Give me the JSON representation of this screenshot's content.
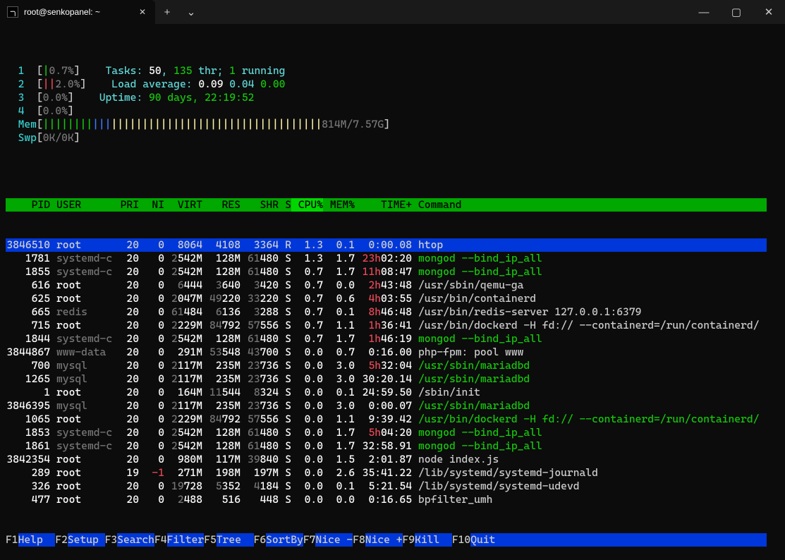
{
  "window": {
    "tab_title": "root@senkopanel: ~",
    "tab_icon": "terminal-icon",
    "close_glyph": "✕",
    "newtab_glyph": "+",
    "dropdown_glyph": "⌄",
    "min_glyph": "—",
    "max_glyph": "▢",
    "winclose_glyph": "✕"
  },
  "cpu_meters": [
    {
      "id": "1",
      "bar": "|",
      "bar_class": "green",
      "pct": "0.7%"
    },
    {
      "id": "2",
      "bar": "||",
      "bar_class": "red",
      "pct": "2.0%"
    },
    {
      "id": "3",
      "bar": "",
      "bar_class": "",
      "pct": "0.0%"
    },
    {
      "id": "4",
      "bar": "",
      "bar_class": "",
      "pct": "0.0%"
    }
  ],
  "mem": {
    "label": "Mem",
    "green_bars": 8,
    "blue_bars": 3,
    "yellow_bars": 34,
    "used": "814M",
    "total": "7.57G"
  },
  "swp": {
    "label": "Swp",
    "used": "0K",
    "total": "0K"
  },
  "tasks": {
    "label": "Tasks:",
    "procs": "50",
    "sep1": ",",
    "thr": "135",
    "thr_label": "thr;",
    "running": "1",
    "running_label": "running"
  },
  "load": {
    "label": "Load average:",
    "v1": "0.09",
    "v2": "0.04",
    "v3": "0.00"
  },
  "uptime": {
    "label": "Uptime:",
    "value": "90 days, 22:19:52"
  },
  "headers": {
    "pid": "PID",
    "user": "USER",
    "pri": "PRI",
    "ni": "NI",
    "virt": "VIRT",
    "res": "RES",
    "shr": "SHR",
    "s": "S",
    "cpu": "CPU%",
    "mem": "MEM%",
    "time": "TIME+",
    "cmd": "Command"
  },
  "processes": [
    {
      "pid": "3846510",
      "user": "root",
      "uclr": "bwhite",
      "pri": "20",
      "ni": "0",
      "virt": "8064",
      "res": "4108",
      "shr": "3364",
      "s": "R",
      "cpu": "1.3",
      "mem": "0.1",
      "time_red": "",
      "time_rest": "0:00.08",
      "cmd": "htop",
      "cmd_clr": "",
      "sel": true
    },
    {
      "pid": "1781",
      "user": "systemd-c",
      "uclr": "dim",
      "pri": "20",
      "ni": "0",
      "virt": "2542M",
      "res": "128M",
      "shr": "61480",
      "s": "S",
      "cpu": "1.3",
      "mem": "1.7",
      "time_red": "23h",
      "time_rest": "02:20",
      "cmd": "mongod --bind_ip_all",
      "cmd_clr": "green"
    },
    {
      "pid": "1855",
      "user": "systemd-c",
      "uclr": "dim",
      "pri": "20",
      "ni": "0",
      "virt": "2542M",
      "res": "128M",
      "shr": "61480",
      "s": "S",
      "cpu": "0.7",
      "mem": "1.7",
      "time_red": "11h",
      "time_rest": "08:47",
      "cmd": "mongod --bind_ip_all",
      "cmd_clr": "green"
    },
    {
      "pid": "616",
      "user": "root",
      "uclr": "bwhite",
      "pri": "20",
      "ni": "0",
      "virt": "6444",
      "res": "3640",
      "shr": "3420",
      "s": "S",
      "cpu": "0.7",
      "mem": "0.0",
      "time_red": "2h",
      "time_rest": "43:48",
      "cmd": "/usr/sbin/qemu-ga",
      "cmd_clr": ""
    },
    {
      "pid": "625",
      "user": "root",
      "uclr": "bwhite",
      "pri": "20",
      "ni": "0",
      "virt": "2047M",
      "res": "49220",
      "shr": "33220",
      "s": "S",
      "cpu": "0.7",
      "mem": "0.6",
      "time_red": "4h",
      "time_rest": "03:55",
      "cmd": "/usr/bin/containerd",
      "cmd_clr": ""
    },
    {
      "pid": "665",
      "user": "redis",
      "uclr": "dim",
      "pri": "20",
      "ni": "0",
      "virt": "61484",
      "res": "6136",
      "shr": "3288",
      "s": "S",
      "cpu": "0.7",
      "mem": "0.1",
      "time_red": "8h",
      "time_rest": "46:48",
      "cmd": "/usr/bin/redis-server 127.0.0.1:6379",
      "cmd_clr": ""
    },
    {
      "pid": "715",
      "user": "root",
      "uclr": "bwhite",
      "pri": "20",
      "ni": "0",
      "virt": "2229M",
      "res": "84792",
      "shr": "57556",
      "s": "S",
      "cpu": "0.7",
      "mem": "1.1",
      "time_red": "1h",
      "time_rest": "36:41",
      "cmd": "/usr/bin/dockerd -H fd:// --containerd=/run/containerd/",
      "cmd_clr": ""
    },
    {
      "pid": "1844",
      "user": "systemd-c",
      "uclr": "dim",
      "pri": "20",
      "ni": "0",
      "virt": "2542M",
      "res": "128M",
      "shr": "61480",
      "s": "S",
      "cpu": "0.7",
      "mem": "1.7",
      "time_red": "1h",
      "time_rest": "46:19",
      "cmd": "mongod --bind_ip_all",
      "cmd_clr": "green"
    },
    {
      "pid": "3844867",
      "user": "www-data",
      "uclr": "dim",
      "pri": "20",
      "ni": "0",
      "virt": "291M",
      "res": "53548",
      "shr": "43700",
      "s": "S",
      "cpu": "0.0",
      "mem": "0.7",
      "time_red": "",
      "time_rest": "0:16.00",
      "cmd": "php-fpm: pool www",
      "cmd_clr": ""
    },
    {
      "pid": "700",
      "user": "mysql",
      "uclr": "dim",
      "pri": "20",
      "ni": "0",
      "virt": "2117M",
      "res": "235M",
      "shr": "23736",
      "s": "S",
      "cpu": "0.0",
      "mem": "3.0",
      "time_red": "5h",
      "time_rest": "32:04",
      "cmd": "/usr/sbin/mariadbd",
      "cmd_clr": "green"
    },
    {
      "pid": "1265",
      "user": "mysql",
      "uclr": "dim",
      "pri": "20",
      "ni": "0",
      "virt": "2117M",
      "res": "235M",
      "shr": "23736",
      "s": "S",
      "cpu": "0.0",
      "mem": "3.0",
      "time_red": "",
      "time_rest": "30:20.14",
      "cmd": "/usr/sbin/mariadbd",
      "cmd_clr": "green"
    },
    {
      "pid": "1",
      "user": "root",
      "uclr": "bwhite",
      "pri": "20",
      "ni": "0",
      "virt": "164M",
      "res": "11544",
      "shr": "8324",
      "s": "S",
      "cpu": "0.0",
      "mem": "0.1",
      "time_red": "",
      "time_rest": "24:59.50",
      "cmd": "/sbin/init",
      "cmd_clr": ""
    },
    {
      "pid": "3846395",
      "user": "mysql",
      "uclr": "dim",
      "pri": "20",
      "ni": "0",
      "virt": "2117M",
      "res": "235M",
      "shr": "23736",
      "s": "S",
      "cpu": "0.0",
      "mem": "3.0",
      "time_red": "",
      "time_rest": "0:00.07",
      "cmd": "/usr/sbin/mariadbd",
      "cmd_clr": "green"
    },
    {
      "pid": "1065",
      "user": "root",
      "uclr": "bwhite",
      "pri": "20",
      "ni": "0",
      "virt": "2229M",
      "res": "84792",
      "shr": "57556",
      "s": "S",
      "cpu": "0.0",
      "mem": "1.1",
      "time_red": "",
      "time_rest": "9:39.42",
      "cmd": "/usr/bin/dockerd -H fd:// --containerd=/run/containerd/",
      "cmd_clr": "green"
    },
    {
      "pid": "1853",
      "user": "systemd-c",
      "uclr": "dim",
      "pri": "20",
      "ni": "0",
      "virt": "2542M",
      "res": "128M",
      "shr": "61480",
      "s": "S",
      "cpu": "0.0",
      "mem": "1.7",
      "time_red": "5h",
      "time_rest": "04:20",
      "cmd": "mongod --bind_ip_all",
      "cmd_clr": "green"
    },
    {
      "pid": "1861",
      "user": "systemd-c",
      "uclr": "dim",
      "pri": "20",
      "ni": "0",
      "virt": "2542M",
      "res": "128M",
      "shr": "61480",
      "s": "S",
      "cpu": "0.0",
      "mem": "1.7",
      "time_red": "",
      "time_rest": "32:58.91",
      "cmd": "mongod --bind_ip_all",
      "cmd_clr": "green"
    },
    {
      "pid": "3842354",
      "user": "root",
      "uclr": "bwhite",
      "pri": "20",
      "ni": "0",
      "virt": "980M",
      "res": "117M",
      "shr": "39840",
      "s": "S",
      "cpu": "0.0",
      "mem": "1.5",
      "time_red": "",
      "time_rest": "2:01.87",
      "cmd": "node index.js",
      "cmd_clr": ""
    },
    {
      "pid": "289",
      "user": "root",
      "uclr": "bwhite",
      "pri": "19",
      "ni": "-1",
      "ni_clr": "red",
      "virt": "271M",
      "res": "198M",
      "shr": "197M",
      "s": "S",
      "cpu": "0.0",
      "mem": "2.6",
      "time_red": "",
      "time_rest": "35:41.22",
      "cmd": "/lib/systemd/systemd-journald",
      "cmd_clr": ""
    },
    {
      "pid": "326",
      "user": "root",
      "uclr": "bwhite",
      "pri": "20",
      "ni": "0",
      "virt": "19728",
      "res": "5352",
      "shr": "4184",
      "s": "S",
      "cpu": "0.0",
      "mem": "0.1",
      "time_red": "",
      "time_rest": "5:21.54",
      "cmd": "/lib/systemd/systemd-udevd",
      "cmd_clr": ""
    },
    {
      "pid": "477",
      "user": "root",
      "uclr": "bwhite",
      "pri": "20",
      "ni": "0",
      "virt": "2488",
      "res": "516",
      "shr": "448",
      "s": "S",
      "cpu": "0.0",
      "mem": "0.0",
      "time_red": "",
      "time_rest": "0:16.65",
      "cmd": "bpfilter_umh",
      "cmd_clr": ""
    }
  ],
  "fnkeys": [
    {
      "key": "F1",
      "label": "Help  "
    },
    {
      "key": "F2",
      "label": "Setup "
    },
    {
      "key": "F3",
      "label": "Search"
    },
    {
      "key": "F4",
      "label": "Filter"
    },
    {
      "key": "F5",
      "label": "Tree  "
    },
    {
      "key": "F6",
      "label": "SortBy"
    },
    {
      "key": "F7",
      "label": "Nice -"
    },
    {
      "key": "F8",
      "label": "Nice +"
    },
    {
      "key": "F9",
      "label": "Kill  "
    },
    {
      "key": "F10",
      "label": "Quit"
    }
  ]
}
